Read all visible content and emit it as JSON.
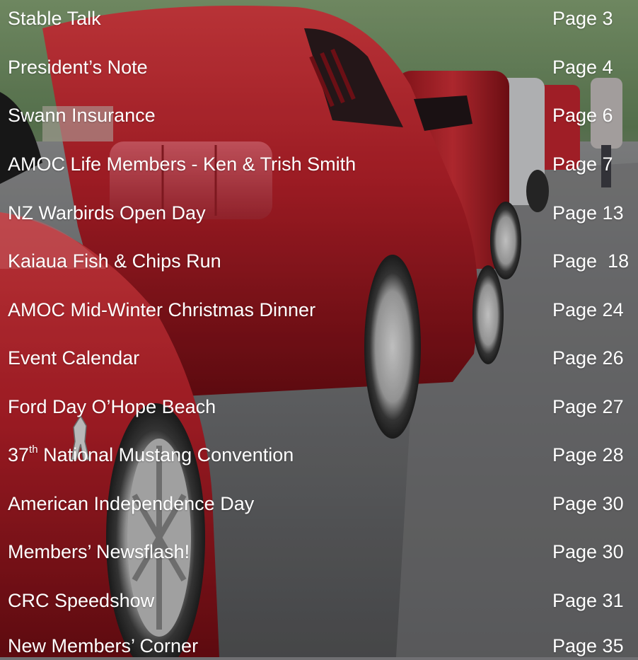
{
  "toc": {
    "items": [
      {
        "title": "Stable Talk",
        "page": "Page 3"
      },
      {
        "title": "President’s Note",
        "page": "Page 4"
      },
      {
        "title": "Swann Insurance",
        "page": "Page 6"
      },
      {
        "title": "AMOC Life Members - Ken & Trish Smith",
        "page": "Page 7"
      },
      {
        "title": "NZ Warbirds Open Day",
        "page": "Page 13"
      },
      {
        "title": "Kaiaua Fish & Chips Run",
        "page": "Page  18"
      },
      {
        "title": "AMOC Mid-Winter Christmas Dinner",
        "page": "Page 24"
      },
      {
        "title": "Event Calendar",
        "page": "Page 26"
      },
      {
        "title": "Ford Day O’Hope Beach",
        "page": "Page 27"
      },
      {
        "title_prefix": "37",
        "title_sup": "th",
        "title": " National Mustang Convention",
        "page": "Page 28"
      },
      {
        "title": "American Independence Day",
        "page": "Page 30"
      },
      {
        "title": "Members’ Newsflash!",
        "page": "Page 30"
      },
      {
        "title": "CRC Speedshow",
        "page": "Page 31"
      },
      {
        "title": "New Members’ Corner",
        "page": "Page 35"
      }
    ]
  },
  "colors": {
    "text": "#ffffff",
    "car_red": "#b3202a",
    "road": "#6f6f72"
  },
  "background": {
    "scene": "row of red Ford Mustang cars parked along a road",
    "icon": "mustang-emblem"
  }
}
